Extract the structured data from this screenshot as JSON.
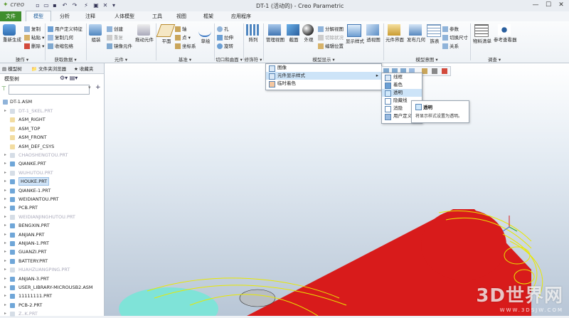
{
  "app": {
    "logo": "creo",
    "window_title": "DT-1 (活动的) - Creo Parametric",
    "window_controls": [
      "minimize-icon",
      "maximize-icon",
      "close-icon"
    ]
  },
  "tabs": [
    {
      "label": "文件"
    },
    {
      "label": "模型"
    },
    {
      "label": "分析"
    },
    {
      "label": "注释"
    },
    {
      "label": "人体模型"
    },
    {
      "label": "视图"
    },
    {
      "label": "工具"
    },
    {
      "label": "框架"
    },
    {
      "label": "应用程序"
    }
  ],
  "ribbon": {
    "groups": [
      {
        "label": "操作 ▾",
        "items": [
          "重新生成",
          "复制",
          "粘贴 ▾",
          "删除 ▾"
        ]
      },
      {
        "label": "获取数据 ▾",
        "items": [
          "用户定义特征",
          "复制几何",
          "收缩包络"
        ]
      },
      {
        "label": "元件 ▾",
        "items": [
          "组装",
          "创建",
          "重复",
          "镜像元件",
          "拖动元件"
        ]
      },
      {
        "label": "基准 ▾",
        "items": [
          "平面",
          "轴",
          "点 ▾",
          "坐标系",
          "草绘"
        ]
      },
      {
        "label": "切口和曲面 ▾",
        "items": [
          "孔",
          "拉伸",
          "旋转"
        ]
      },
      {
        "label": "修饰符 ▾",
        "items": [
          "阵列"
        ]
      },
      {
        "label": "模型显示 ▾",
        "items": [
          "管理视图",
          "截面",
          "外观",
          "分解视图",
          "切除状况",
          "编辑位置",
          "显示样式",
          "透视图"
        ]
      },
      {
        "label": "模型意图 ▾",
        "items": [
          "元件界面",
          "发布几何",
          "族表",
          "参数",
          "切换尺寸",
          "关系"
        ]
      },
      {
        "label": "调查 ▾",
        "items": [
          "物料清单",
          "参考查看器"
        ]
      }
    ]
  },
  "panel": {
    "tabs": [
      "模型树",
      "文件夹浏览器",
      "收藏夹"
    ],
    "tree_title": "模型树",
    "filter_placeholder": "",
    "root": "DT-1.ASM",
    "items": [
      {
        "label": "DT-1_SKEL.PRT",
        "muted": true
      },
      {
        "label": "ASM_RIGHT"
      },
      {
        "label": "ASM_TOP"
      },
      {
        "label": "ASM_FRONT"
      },
      {
        "label": "ASM_DEF_CSYS"
      },
      {
        "label": "CHAOSHENGTOU.PRT",
        "muted": true
      },
      {
        "label": "QIANKE.PRT"
      },
      {
        "label": "WUHUTOU.PRT",
        "muted": true
      },
      {
        "label": "HOUKE.PRT",
        "selected": true
      },
      {
        "label": "QIANKE-1.PRT"
      },
      {
        "label": "WEIDIANTOU.PRT"
      },
      {
        "label": "PCB.PRT"
      },
      {
        "label": "WEIDIANJINGHUTOU.PRT",
        "muted": true
      },
      {
        "label": "BENGXIN.PRT"
      },
      {
        "label": "ANJIAN.PRT"
      },
      {
        "label": "ANJIAN-1.PRT"
      },
      {
        "label": "GUANZI.PRT"
      },
      {
        "label": "BATTERY.PRT"
      },
      {
        "label": "HUAHZUANGPING.PRT",
        "muted": true
      },
      {
        "label": "ANJIAN-3.PRT"
      },
      {
        "label": "USER_LIBRARY-MICROUSB2.ASM"
      },
      {
        "label": "11111111.PRT"
      },
      {
        "label": "PCB-2.PRT"
      },
      {
        "label": "Z..K.PRT",
        "muted": true
      }
    ]
  },
  "dropdown": {
    "items": [
      "图像",
      "元件显示样式",
      "临时着色"
    ],
    "submenu": [
      "线框",
      "着色",
      "透明",
      "隐藏线",
      "消隐",
      "用户定义"
    ],
    "tooltip_title": "透明",
    "tooltip_text": "将显示样式设置为透明。"
  },
  "watermark": {
    "text": "3D世界网",
    "url": "WWW.3DSJW.COM"
  },
  "colors": {
    "file_tab": "#3f8e2e",
    "accent": "#1f5e9c",
    "part_red": "#d81b1b",
    "part_cyan": "#7fe3d8",
    "wire_yellow": "#e8e800"
  }
}
